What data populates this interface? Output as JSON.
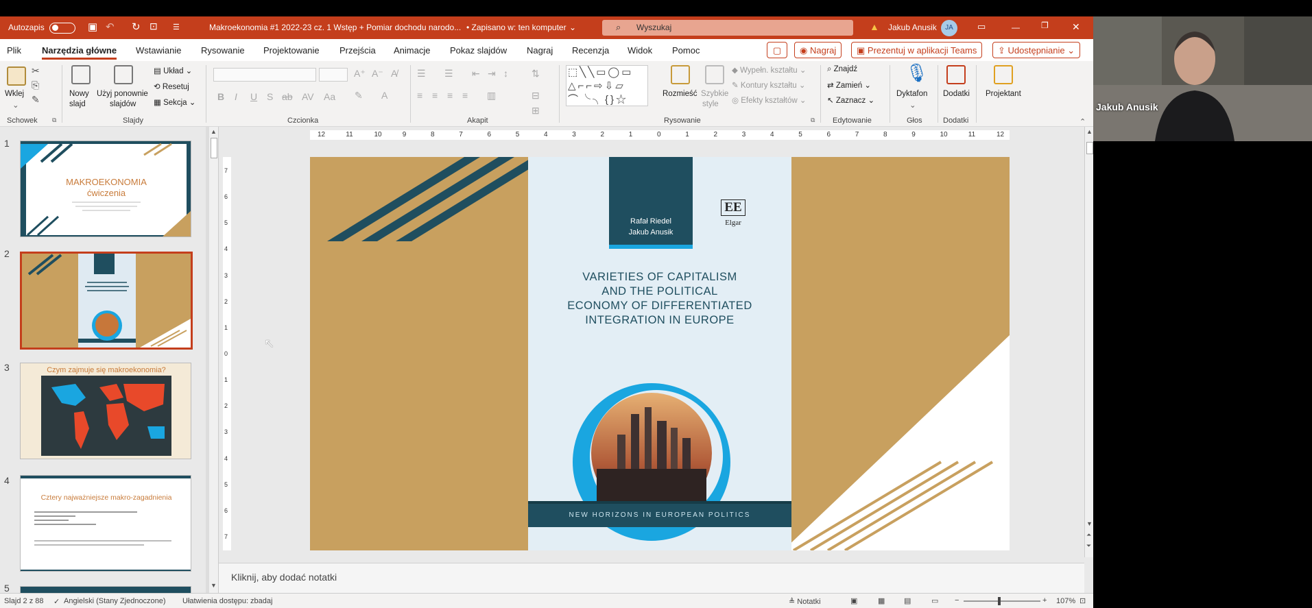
{
  "titlebar": {
    "autosave_label": "Autozapis",
    "doc_title": "Makroekonomia #1 2022-23 cz. 1 Wstęp + Pomiar dochodu narodo...",
    "save_status": "• Zapisano w: ten komputer",
    "search_placeholder": "Wyszukaj",
    "user_name": "Jakub Anusik",
    "user_initials": "JA"
  },
  "tabs": [
    "Plik",
    "Narzędzia główne",
    "Wstawianie",
    "Rysowanie",
    "Projektowanie",
    "Przejścia",
    "Animacje",
    "Pokaz slajdów",
    "Nagraj",
    "Recenzja",
    "Widok",
    "Pomoc"
  ],
  "actions": {
    "record": "Nagraj",
    "present_teams": "Prezentuj w aplikacji Teams",
    "share": "Udostępnianie"
  },
  "ribbon": {
    "paste": "Wklej",
    "clipboard_group": "Schowek",
    "new_slide": "Nowy",
    "new_slide2": "slajd",
    "reuse": "Użyj ponownie",
    "reuse2": "slajdów",
    "layout": "Układ",
    "reset": "Resetuj",
    "section": "Sekcja",
    "slides_group": "Slajdy",
    "font_group": "Czcionka",
    "paragraph_group": "Akapit",
    "arrange": "Rozmieść",
    "quick_styles": "Szybkie",
    "quick_styles2": "style",
    "fill": "Wypełn. kształtu",
    "outline": "Kontury kształtu",
    "effects": "Efekty kształtów",
    "drawing_group": "Rysowanie",
    "find": "Znajdź",
    "replace": "Zamień",
    "select": "Zaznacz",
    "editing_group": "Edytowanie",
    "dictate": "Dyktafon",
    "voice_group": "Głos",
    "addins": "Dodatki",
    "addins_group": "Dodatki",
    "designer": "Projektant"
  },
  "thumbnails": [
    {
      "number": "1",
      "title": "MAKROEKONOMIA",
      "subtitle": "ćwiczenia"
    },
    {
      "number": "2"
    },
    {
      "number": "3",
      "title": "Czym zajmuje się makroekonomia?"
    },
    {
      "number": "4",
      "title": "Cztery najważniejsze makro-zagadnienia"
    },
    {
      "number": "5"
    }
  ],
  "ruler": {
    "top": [
      "12",
      "11",
      "10",
      "9",
      "8",
      "7",
      "6",
      "5",
      "4",
      "3",
      "2",
      "1",
      "0",
      "1",
      "2",
      "3",
      "4",
      "5",
      "6",
      "7",
      "8",
      "9",
      "10",
      "11",
      "12"
    ],
    "left": [
      "7",
      "6",
      "5",
      "4",
      "3",
      "2",
      "1",
      "0",
      "1",
      "2",
      "3",
      "4",
      "5",
      "6",
      "7"
    ]
  },
  "slide": {
    "authors": [
      "Rafał Riedel",
      "Jakub Anusik"
    ],
    "publisher_logo": "EE",
    "publisher_name": "Elgar",
    "book_title": [
      "VARIETIES OF CAPITALISM",
      "AND THE POLITICAL",
      "ECONOMY OF DIFFERENTIATED",
      "INTEGRATION IN EUROPE"
    ],
    "series": "NEW HORIZONS IN EUROPEAN POLITICS"
  },
  "notes_placeholder": "Kliknij, aby dodać notatki",
  "status": {
    "slide_counter": "Slajd 2 z 88",
    "language": "Angielski (Stany Zjednoczone)",
    "accessibility": "Ułatwienia dostępu: zbadaj",
    "notes": "Notatki",
    "zoom": "107%"
  },
  "video": {
    "participant_name": "Jakub Anusik"
  },
  "colors": {
    "accent": "#c43e1c",
    "slide_tan": "#c8a05f",
    "navy": "#1f4e5f",
    "cyan": "#1aa6e0"
  }
}
